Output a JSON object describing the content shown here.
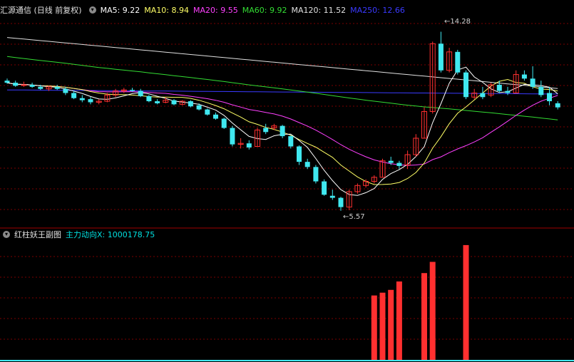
{
  "main_header": {
    "title": "汇源通信 (日线 前复权)",
    "indicators": [
      {
        "label": "MA5: 9.22",
        "color": "#ffffff"
      },
      {
        "label": "MA10: 8.94",
        "color": "#ffff66"
      },
      {
        "label": "MA20: 9.55",
        "color": "#ff40ff"
      },
      {
        "label": "MA60: 9.92",
        "color": "#33dd33"
      },
      {
        "label": "MA120: 11.52",
        "color": "#e0e0e0"
      },
      {
        "label": "MA250: 12.66",
        "color": "#3a3aff"
      }
    ]
  },
  "sub_header": {
    "title": "红柱妖王副图",
    "indicator_label": "主力动向X: 1000178.75",
    "indicator_color": "#00e0e0"
  },
  "annotations": {
    "high_label": "14.28",
    "low_label": "5.57"
  },
  "colors": {
    "up": "#ff3030",
    "down": "#40e8f0",
    "grid": "#7a0000",
    "border": "#a00000"
  },
  "chart_data": {
    "type": "candlestick",
    "price_range": [
      4.8,
      15.2
    ],
    "high_value": 14.28,
    "low_value": 5.57,
    "candles": [
      [
        11.9,
        12.0,
        11.75,
        11.8
      ],
      [
        11.8,
        11.9,
        11.6,
        11.65
      ],
      [
        11.7,
        11.85,
        11.6,
        11.7
      ],
      [
        11.7,
        11.8,
        11.55,
        11.6
      ],
      [
        11.6,
        11.7,
        11.45,
        11.5
      ],
      [
        11.5,
        11.65,
        11.4,
        11.6
      ],
      [
        11.6,
        11.7,
        11.45,
        11.5
      ],
      [
        11.5,
        11.6,
        11.2,
        11.3
      ],
      [
        11.3,
        11.4,
        11.0,
        11.05
      ],
      [
        11.05,
        11.2,
        10.85,
        10.95
      ],
      [
        11.0,
        11.1,
        10.75,
        10.85
      ],
      [
        10.85,
        11.0,
        10.75,
        10.9
      ],
      [
        10.9,
        11.3,
        10.85,
        11.2
      ],
      [
        11.2,
        11.5,
        11.1,
        11.4
      ],
      [
        11.4,
        11.55,
        11.3,
        11.45
      ],
      [
        11.45,
        11.55,
        11.35,
        11.4
      ],
      [
        11.4,
        11.5,
        11.1,
        11.15
      ],
      [
        11.15,
        11.2,
        10.85,
        10.9
      ],
      [
        10.9,
        11.0,
        10.75,
        10.8
      ],
      [
        10.85,
        11.1,
        10.8,
        10.95
      ],
      [
        10.95,
        11.0,
        10.7,
        10.75
      ],
      [
        10.75,
        10.95,
        10.7,
        10.9
      ],
      [
        10.9,
        10.95,
        10.6,
        10.65
      ],
      [
        10.7,
        10.8,
        10.45,
        10.5
      ],
      [
        10.5,
        10.55,
        10.2,
        10.25
      ],
      [
        10.25,
        10.35,
        10.0,
        10.05
      ],
      [
        10.05,
        10.1,
        9.55,
        9.6
      ],
      [
        9.6,
        9.7,
        8.7,
        8.8
      ],
      [
        8.8,
        9.1,
        8.6,
        8.85
      ],
      [
        8.85,
        9.0,
        8.55,
        8.65
      ],
      [
        8.7,
        9.6,
        8.7,
        9.5
      ],
      [
        9.6,
        9.8,
        9.3,
        9.4
      ],
      [
        9.6,
        9.8,
        9.5,
        9.7
      ],
      [
        9.7,
        9.75,
        9.1,
        9.2
      ],
      [
        9.2,
        9.25,
        8.6,
        8.7
      ],
      [
        8.7,
        8.75,
        7.8,
        7.95
      ],
      [
        7.95,
        8.1,
        7.6,
        7.7
      ],
      [
        7.7,
        7.8,
        6.9,
        7.0
      ],
      [
        7.0,
        7.1,
        6.3,
        6.35
      ],
      [
        6.3,
        6.6,
        6.1,
        6.2
      ],
      [
        6.2,
        6.25,
        5.57,
        5.75
      ],
      [
        5.75,
        6.6,
        5.6,
        6.5
      ],
      [
        6.5,
        6.9,
        6.4,
        6.8
      ],
      [
        6.8,
        7.1,
        6.7,
        7.0
      ],
      [
        7.0,
        7.3,
        6.9,
        7.2
      ],
      [
        7.2,
        8.1,
        7.2,
        8.0
      ],
      [
        8.0,
        8.2,
        7.8,
        7.9
      ],
      [
        7.9,
        8.0,
        7.6,
        7.75
      ],
      [
        7.8,
        8.5,
        7.6,
        8.3
      ],
      [
        8.3,
        9.3,
        8.2,
        9.1
      ],
      [
        9.1,
        10.6,
        9.1,
        10.4
      ],
      [
        10.4,
        13.8,
        10.3,
        13.7
      ],
      [
        13.7,
        14.28,
        12.3,
        12.4
      ],
      [
        12.4,
        13.5,
        12.3,
        13.3
      ],
      [
        13.3,
        13.4,
        12.2,
        12.3
      ],
      [
        12.3,
        12.4,
        11.0,
        11.1
      ],
      [
        11.1,
        11.5,
        11.0,
        11.3
      ],
      [
        11.3,
        11.6,
        11.0,
        11.1
      ],
      [
        11.2,
        11.8,
        11.1,
        11.7
      ],
      [
        11.7,
        11.9,
        11.3,
        11.4
      ],
      [
        11.4,
        11.6,
        11.2,
        11.3
      ],
      [
        11.3,
        12.4,
        11.3,
        12.2
      ],
      [
        12.2,
        12.4,
        11.9,
        12.0
      ],
      [
        12.0,
        12.6,
        11.5,
        11.6
      ],
      [
        11.6,
        11.9,
        11.1,
        11.2
      ],
      [
        11.3,
        11.6,
        10.7,
        10.9
      ],
      [
        10.8,
        10.9,
        10.5,
        10.6
      ]
    ],
    "indicator_bars": [
      {
        "index": 44,
        "value": 230
      },
      {
        "index": 45,
        "value": 240
      },
      {
        "index": 46,
        "value": 250
      },
      {
        "index": 47,
        "value": 280
      },
      {
        "index": 50,
        "value": 310
      },
      {
        "index": 51,
        "value": 350
      },
      {
        "index": 55,
        "value": 410
      }
    ]
  }
}
